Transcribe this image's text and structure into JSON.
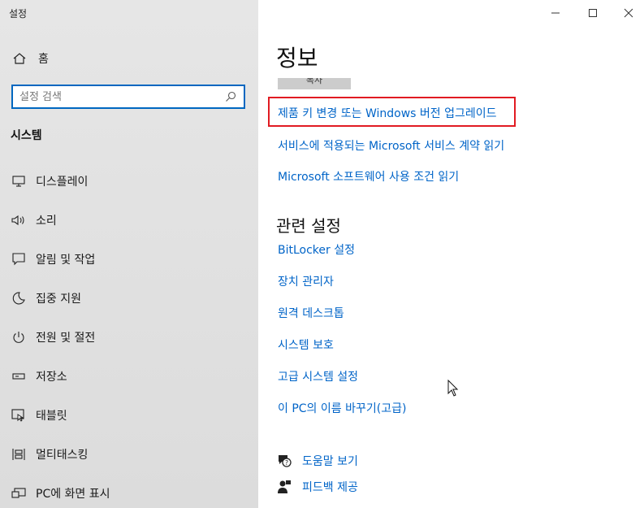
{
  "app": {
    "title": "설정"
  },
  "sidebar": {
    "home_label": "홈",
    "search_placeholder": "설정 검색",
    "section_label": "시스템",
    "items": [
      {
        "label": "디스플레이",
        "icon": "monitor-icon"
      },
      {
        "label": "소리",
        "icon": "speaker-icon"
      },
      {
        "label": "알림 및 작업",
        "icon": "notification-icon"
      },
      {
        "label": "집중 지원",
        "icon": "moon-icon"
      },
      {
        "label": "전원 및 절전",
        "icon": "power-icon"
      },
      {
        "label": "저장소",
        "icon": "storage-icon"
      },
      {
        "label": "태블릿",
        "icon": "tablet-icon"
      },
      {
        "label": "멀티태스킹",
        "icon": "multitasking-icon"
      },
      {
        "label": "PC에 화면 표시",
        "icon": "project-icon"
      }
    ]
  },
  "main": {
    "title": "정보",
    "copy_button": "복사",
    "links": [
      "제품 키 변경 또는 Windows 버전 업그레이드",
      "서비스에 적용되는 Microsoft 서비스 계약 읽기",
      "Microsoft 소프트웨어 사용 조건 읽기"
    ],
    "related_title": "관련 설정",
    "related_links": [
      "BitLocker 설정",
      "장치 관리자",
      "원격 데스크톱",
      "시스템 보호",
      "고급 시스템 설정",
      "이 PC의 이름 바꾸기(고급)"
    ],
    "help": {
      "get_help": "도움말 보기",
      "feedback": "피드백 제공"
    }
  },
  "colors": {
    "accent": "#0064c8",
    "highlight": "#e11b22"
  }
}
